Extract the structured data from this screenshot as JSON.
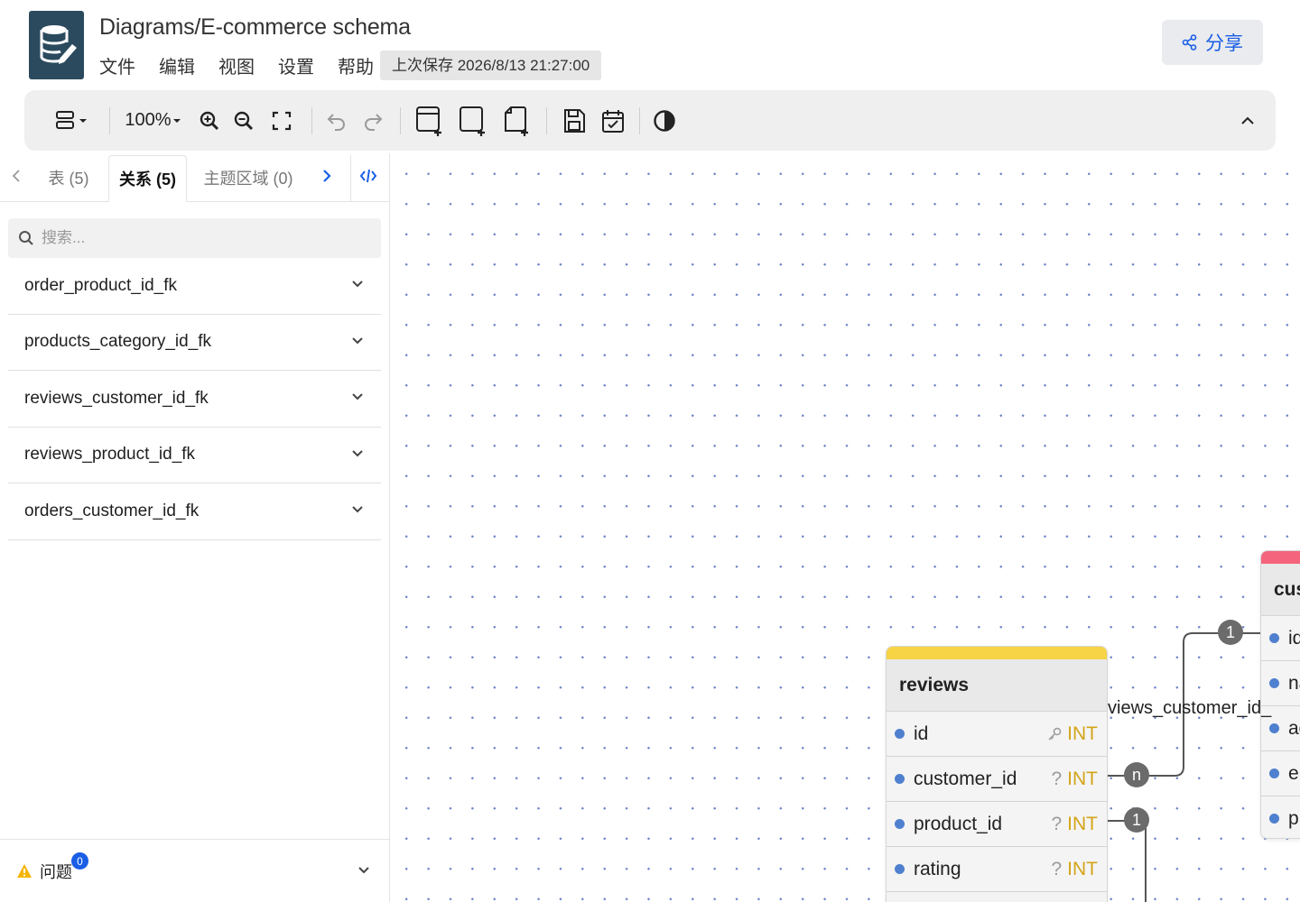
{
  "header": {
    "title": "Diagrams/E-commerce schema",
    "menu": [
      "文件",
      "编辑",
      "视图",
      "设置",
      "帮助"
    ],
    "last_saved": "上次保存 2026/8/13 21:27:00",
    "share_label": "分享"
  },
  "toolbar": {
    "zoom": "100%",
    "icons": [
      "layout-icon",
      "zoom-in-icon",
      "zoom-out-icon",
      "fullscreen-icon",
      "undo-icon",
      "redo-icon",
      "add-table-icon",
      "add-area-icon",
      "add-note-icon",
      "save-icon",
      "todo-icon",
      "theme-icon",
      "collapse-icon"
    ]
  },
  "sidebar": {
    "tabs": [
      {
        "label": "表 (5)"
      },
      {
        "label": "关系 (5)"
      },
      {
        "label": "主题区域 (0)"
      }
    ],
    "search_placeholder": "搜索...",
    "relationships": [
      {
        "label": "order_product_id_fk"
      },
      {
        "label": "products_category_id_fk"
      },
      {
        "label": "reviews_customer_id_fk"
      },
      {
        "label": "reviews_product_id_fk"
      },
      {
        "label": "orders_customer_id_fk"
      }
    ],
    "issues": {
      "label": "问题",
      "count": "0"
    }
  },
  "canvas": {
    "reviews": {
      "name": "reviews",
      "color": "#f7d346",
      "fields": [
        {
          "name": "id",
          "mark": "key-icon",
          "type": "INT"
        },
        {
          "name": "customer_id",
          "mark": "?",
          "type": "INT"
        },
        {
          "name": "product_id",
          "mark": "?",
          "type": "INT"
        },
        {
          "name": "rating",
          "mark": "?",
          "type": "INT"
        }
      ]
    },
    "customers": {
      "name": "cus",
      "color": "#f4647d",
      "fields": [
        {
          "name": "id"
        },
        {
          "name": "na"
        },
        {
          "name": "ad"
        },
        {
          "name": "er"
        },
        {
          "name": "pl"
        }
      ]
    },
    "relation_label": "views_customer_id_",
    "badges": {
      "one_top": "1",
      "many": "n",
      "one_bottom": "1"
    }
  }
}
